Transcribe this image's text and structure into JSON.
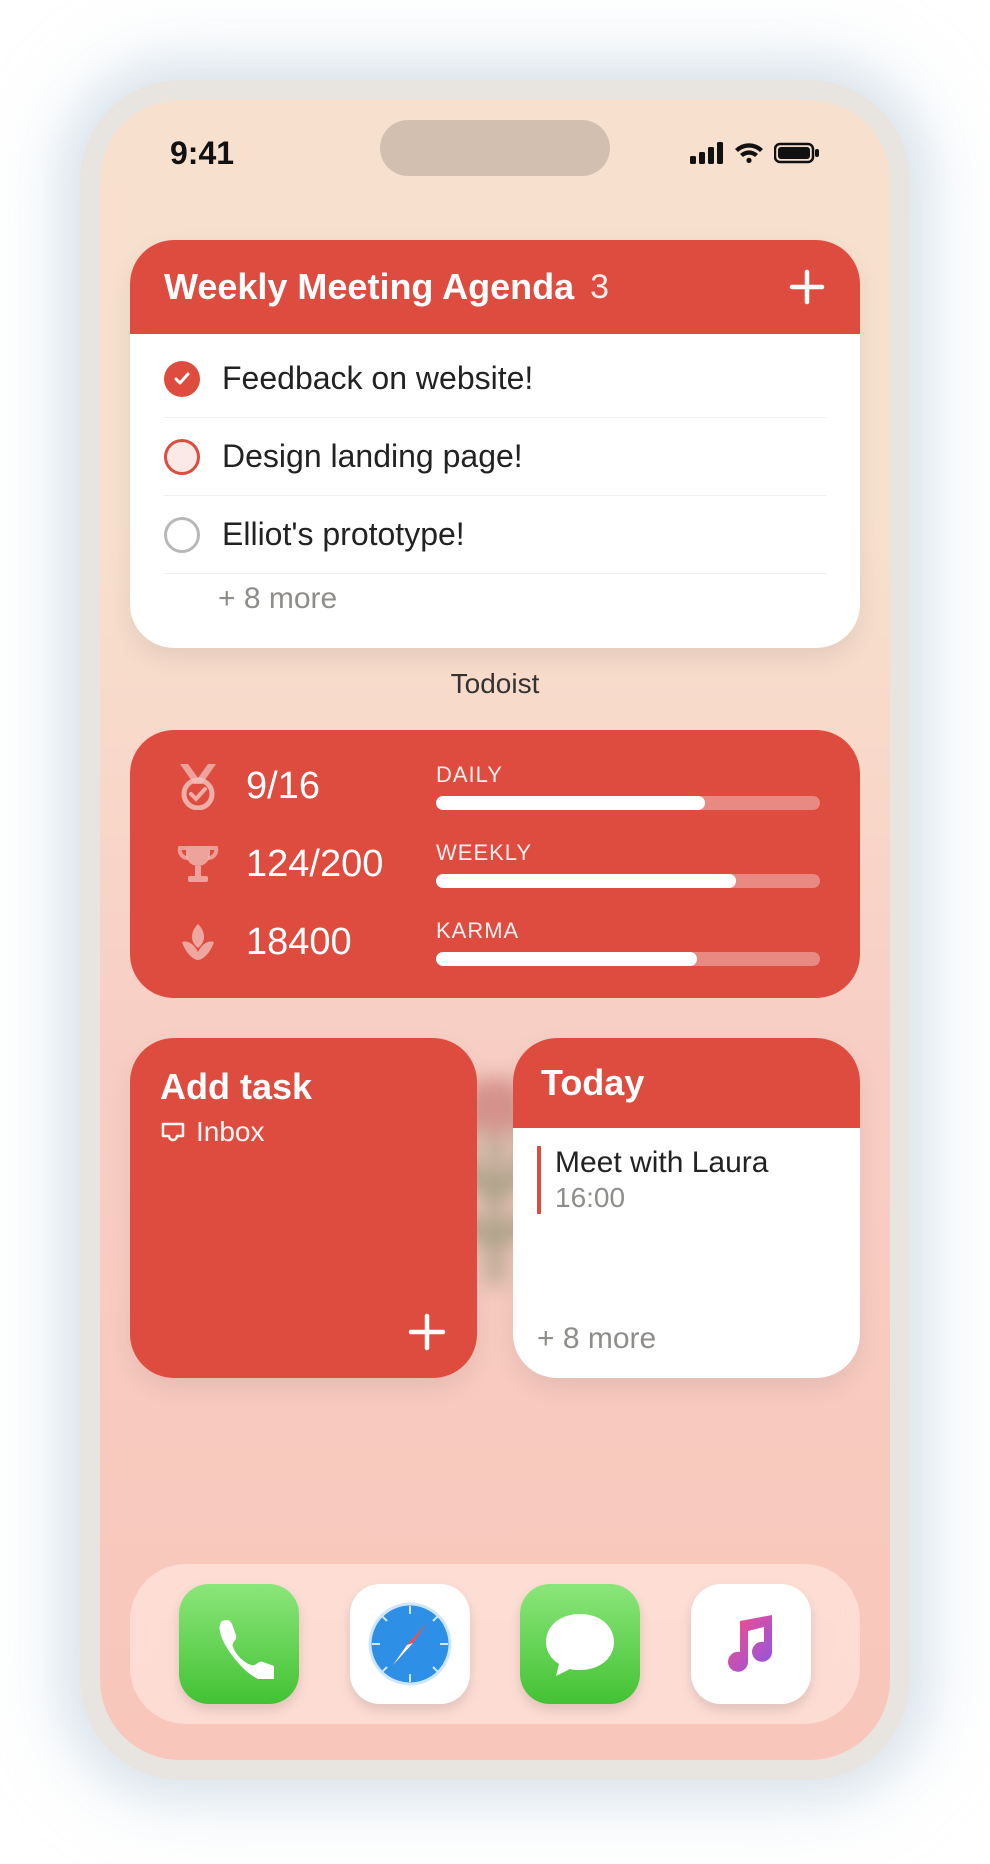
{
  "status": {
    "time": "9:41"
  },
  "agenda": {
    "title": "Weekly Meeting Agenda",
    "count": "3",
    "tasks": [
      {
        "label": "Feedback on website!",
        "state": "done"
      },
      {
        "label": "Design landing page!",
        "state": "open"
      },
      {
        "label": "Elliot's prototype!",
        "state": "none"
      }
    ],
    "more": "+ 8 more",
    "caption": "Todoist"
  },
  "stats": {
    "daily": {
      "label": "DAILY",
      "value": "9/16",
      "pct": 70
    },
    "weekly": {
      "label": "WEEKLY",
      "value": "124/200",
      "pct": 78
    },
    "karma": {
      "label": "KARMA",
      "value": "18400",
      "pct": 68
    }
  },
  "add_task": {
    "title": "Add task",
    "sub": "Inbox"
  },
  "today": {
    "title": "Today",
    "item": {
      "label": "Meet with Laura",
      "time": "16:00"
    },
    "more": "+ 8 more"
  },
  "colors": {
    "accent": "#dd4c3f"
  }
}
